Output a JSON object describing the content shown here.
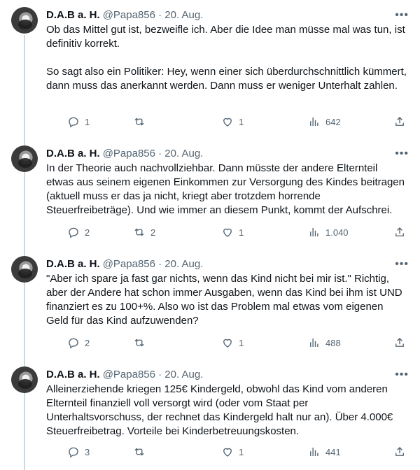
{
  "tweets": [
    {
      "name": "D.A.B a. H.",
      "handle": "@Papa856 · 20. Aug.",
      "text": "Ob das Mittel gut ist, bezweifle ich. Aber die Idee man müsse mal was tun, ist definitiv korrekt.\n\nSo sagt also ein Politiker: Hey, wenn einer sich überdurchschnittlich kümmert, dann muss das anerkannt werden. Dann muss er weniger Unterhalt zahlen.",
      "replies": "1",
      "retweets": "",
      "likes": "1",
      "views": "642"
    },
    {
      "name": "D.A.B a. H.",
      "handle": "@Papa856 · 20. Aug.",
      "text": "In der Theorie auch nachvollziehbar. Dann müsste der andere Elternteil etwas aus seinem eigenen Einkommen zur Versorgung des Kindes beitragen (aktuell muss er das ja nicht, kriegt aber trotzdem horrende Steuerfreibeträge). Und wie immer an diesem Punkt, kommt der Aufschrei.",
      "replies": "2",
      "retweets": "2",
      "likes": "1",
      "views": "1.040"
    },
    {
      "name": "D.A.B a. H.",
      "handle": "@Papa856 · 20. Aug.",
      "text": "\"Aber ich spare ja fast gar nichts, wenn das Kind nicht bei mir ist.\" Richtig, aber der Andere hat schon immer Ausgaben, wenn das Kind bei ihm ist UND finanziert es zu 100+%. Also wo ist das Problem mal etwas vom eigenen Geld für das Kind aufzuwenden?",
      "replies": "2",
      "retweets": "",
      "likes": "1",
      "views": "488"
    },
    {
      "name": "D.A.B a. H.",
      "handle": "@Papa856 · 20. Aug.",
      "text": "Alleinerziehende kriegen 125€ Kindergeld, obwohl das Kind vom anderen Elternteil finanziell voll versorgt wird (oder vom Staat per Unterhaltsvorschuss, der rechnet das Kindergeld halt nur an). Über 4.000€ Steuerfreibetrag. Vorteile bei Kinderbetreuungskosten.",
      "replies": "3",
      "retweets": "",
      "likes": "1",
      "views": "441"
    }
  ],
  "icons": {
    "more": "more-horizontal-icon",
    "reply": "reply-bubble-icon",
    "retweet": "retweet-icon",
    "like": "heart-icon",
    "views": "analytics-bars-icon",
    "share": "share-upload-icon"
  },
  "colors": {
    "text": "#0f1419",
    "secondary": "#536471",
    "thread_line": "#cfd9de"
  }
}
